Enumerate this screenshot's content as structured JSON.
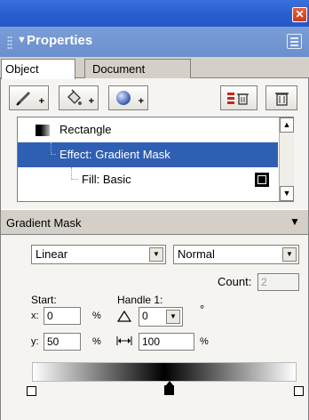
{
  "window": {
    "close_glyph": "✕"
  },
  "panel": {
    "title": "Properties",
    "collapse_glyph": "▼"
  },
  "tabs": [
    {
      "label": "Object",
      "active": true
    },
    {
      "label": "Document",
      "active": false
    }
  ],
  "toolbar": {
    "buttons": [
      {
        "icon": "pencil-icon",
        "plus": "+"
      },
      {
        "icon": "paint-bucket-icon",
        "plus": "+"
      },
      {
        "icon": "effect-sphere-icon",
        "plus": "+"
      },
      {
        "icon": "delete-attribute-icon"
      },
      {
        "icon": "trash-icon"
      }
    ]
  },
  "attributes_list": {
    "items": [
      {
        "label": "Rectangle",
        "selected": false
      },
      {
        "label": "Effect: Gradient Mask",
        "selected": true
      },
      {
        "label": "Fill: Basic",
        "selected": false
      }
    ]
  },
  "gradient_section": {
    "title": "Gradient Mask",
    "type_value": "Linear",
    "blend_value": "Normal",
    "count_label": "Count:",
    "count_value": "2",
    "start_label": "Start:",
    "handle_label": "Handle 1:",
    "x_label": "x:",
    "x_value": "0",
    "y_label": "y:",
    "y_value": "50",
    "percent": "%",
    "angle_value": "0",
    "degree": "°",
    "length_value": "100"
  },
  "colors": {
    "title_blue": "#2a5fcf",
    "panel_header": "#7b9ed6",
    "selection": "#2f5fb3"
  }
}
